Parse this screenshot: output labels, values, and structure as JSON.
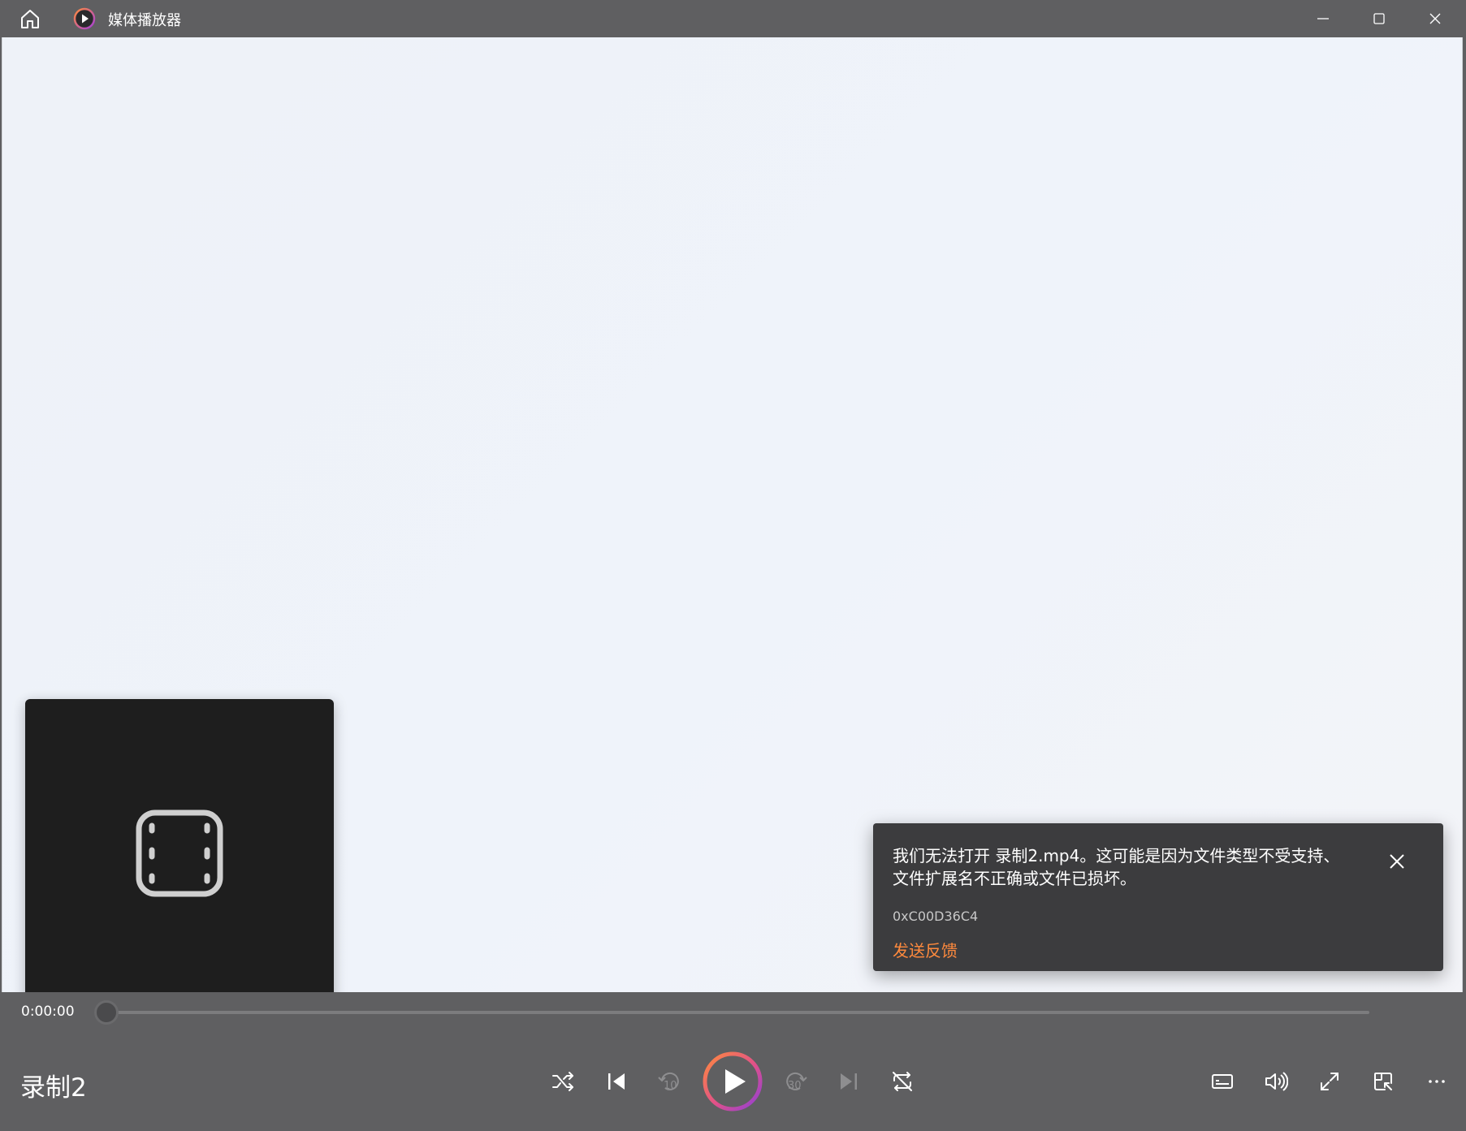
{
  "app": {
    "title": "媒体播放器",
    "accent_color": "#ff8a3d"
  },
  "titlebar": {
    "icons": [
      "home-icon",
      "app-play-icon",
      "minimize-icon",
      "maximize-icon",
      "close-icon"
    ]
  },
  "error_toast": {
    "line1": "我们无法打开 录制2.mp4。这可能是因为文件类型不受支持、",
    "line2": "文件扩展名不正确或文件已损坏。",
    "error_code": "0xC00D36C4",
    "feedback_link": "发送反馈"
  },
  "player": {
    "current_time": "0:00:00",
    "progress": 0,
    "media_title": "录制2",
    "rewind_seconds": "10",
    "forward_seconds": "30",
    "controls": [
      "shuffle-icon",
      "previous-icon",
      "rewind-icon",
      "play-icon",
      "forward-icon",
      "next-icon",
      "repeat-icon",
      "subtitles-icon",
      "volume-icon",
      "fullscreen-icon",
      "miniplayer-icon",
      "more-icon"
    ]
  }
}
